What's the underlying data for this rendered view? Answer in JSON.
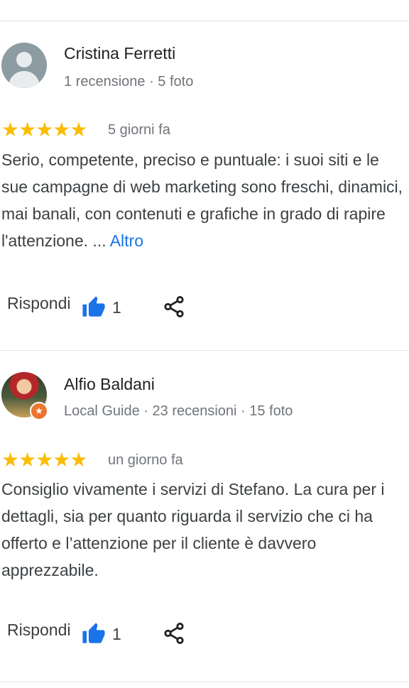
{
  "reviews": [
    {
      "author": "Cristina Ferretti",
      "meta": "1 recensione · 5 foto",
      "stars": "★★★★★",
      "date": "5 giorni fa",
      "text": "Serio, competente, preciso e puntuale: i suoi siti e le sue campagne di web marketing sono freschi, dinamici, mai banali, con contenuti e grafiche in grado di rapire l'attenzione. ...",
      "more_label": "Altro",
      "reply_label": "Rispondi",
      "likes": "1"
    },
    {
      "author": "Alfio Baldani",
      "meta": "Local Guide · 23 recensioni · 15 foto",
      "stars": "★★★★★",
      "date": "un giorno fa",
      "text": "Consiglio vivamente i servizi di Stefano. La cura per i dettagli, sia per quanto riguarda il servizio che ci ha offerto e l’attenzione per il cliente è davvero apprezzabile.",
      "reply_label": "Rispondi",
      "likes": "1",
      "badge_icon": "★"
    }
  ],
  "icons": {
    "avatar_default": "person-icon",
    "like": "thumb-up-icon",
    "share": "share-icon"
  },
  "colors": {
    "star": "#fbbc04",
    "link": "#1a73e8",
    "like_icon": "#1a73e8",
    "badge": "#e9752f"
  }
}
